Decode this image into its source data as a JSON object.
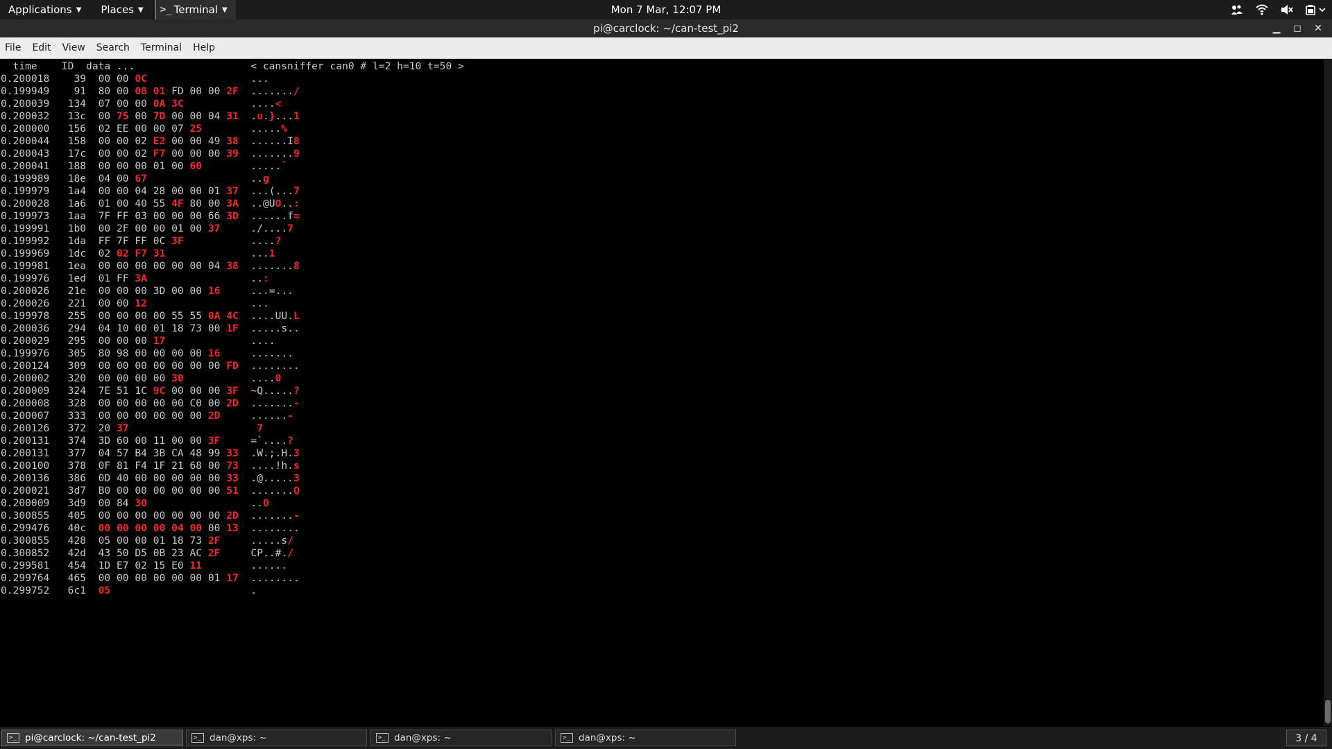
{
  "topbar": {
    "applications": "Applications",
    "places": "Places",
    "terminal_app": "Terminal",
    "clock": "Mon  7 Mar, 12:07 PM",
    "tray_icons": [
      "accessibility-icon",
      "wifi-icon",
      "volume-icon",
      "battery-icon"
    ]
  },
  "window": {
    "title": "pi@carclock: ~/can-test_pi2"
  },
  "menu": [
    "File",
    "Edit",
    "View",
    "Search",
    "Terminal",
    "Help"
  ],
  "terminal": {
    "header": {
      "time": "time",
      "id": "ID",
      "data": "data ...",
      "banner": "< cansniffer can0 # l=2 h=10 t=50 >"
    },
    "rows": [
      {
        "t": "0.200018",
        "id": "39",
        "b": [
          "00",
          "00",
          "0C"
        ],
        "hl": [
          2
        ],
        "a": "..."
      },
      {
        "t": "0.199949",
        "id": "91",
        "b": [
          "80",
          "00",
          "08",
          "01",
          "FD",
          "00",
          "00",
          "2F"
        ],
        "hl": [
          2,
          3,
          7
        ],
        "a": "......./",
        "ahl": [
          7
        ]
      },
      {
        "t": "0.200039",
        "id": "134",
        "b": [
          "07",
          "00",
          "00",
          "0A",
          "3C"
        ],
        "hl": [
          3,
          4
        ],
        "a": "....<",
        "ahl": [
          4
        ]
      },
      {
        "t": "0.200032",
        "id": "13c",
        "b": [
          "00",
          "75",
          "00",
          "7D",
          "00",
          "00",
          "04",
          "31"
        ],
        "hl": [
          1,
          3,
          7
        ],
        "a": ".u.}...1",
        "ahl": [
          1,
          3,
          7
        ]
      },
      {
        "t": "0.200000",
        "id": "156",
        "b": [
          "02",
          "EE",
          "00",
          "00",
          "07",
          "25"
        ],
        "hl": [
          5
        ],
        "a": ".....%",
        "ahl": [
          5
        ]
      },
      {
        "t": "0.200044",
        "id": "158",
        "b": [
          "00",
          "00",
          "02",
          "E2",
          "00",
          "00",
          "49",
          "38"
        ],
        "hl": [
          3,
          7
        ],
        "a": "......I8",
        "ahl": [
          7
        ]
      },
      {
        "t": "0.200043",
        "id": "17c",
        "b": [
          "00",
          "00",
          "02",
          "F7",
          "00",
          "00",
          "00",
          "39"
        ],
        "hl": [
          3,
          7
        ],
        "a": ".......9",
        "ahl": [
          7
        ]
      },
      {
        "t": "0.200041",
        "id": "188",
        "b": [
          "00",
          "00",
          "00",
          "01",
          "00",
          "60"
        ],
        "hl": [
          5
        ],
        "a": ".....`",
        "ahl": [
          5
        ]
      },
      {
        "t": "0.199989",
        "id": "18e",
        "b": [
          "04",
          "00",
          "67"
        ],
        "hl": [
          2
        ],
        "a": "..g",
        "ahl": [
          2
        ]
      },
      {
        "t": "0.199979",
        "id": "1a4",
        "b": [
          "00",
          "00",
          "04",
          "28",
          "00",
          "00",
          "01",
          "37"
        ],
        "hl": [
          7
        ],
        "a": "...(...7",
        "ahl": [
          7
        ]
      },
      {
        "t": "0.200028",
        "id": "1a6",
        "b": [
          "01",
          "00",
          "40",
          "55",
          "4F",
          "80",
          "00",
          "3A"
        ],
        "hl": [
          4,
          7
        ],
        "a": "..@UO..:",
        "ahl": [
          4,
          7
        ]
      },
      {
        "t": "0.199973",
        "id": "1aa",
        "b": [
          "7F",
          "FF",
          "03",
          "00",
          "00",
          "00",
          "66",
          "3D"
        ],
        "hl": [
          7
        ],
        "a": "......f=",
        "ahl": [
          7
        ]
      },
      {
        "t": "0.199991",
        "id": "1b0",
        "b": [
          "00",
          "2F",
          "00",
          "00",
          "01",
          "00",
          "37"
        ],
        "hl": [
          6
        ],
        "a": "./....7",
        "ahl": [
          6
        ]
      },
      {
        "t": "0.199992",
        "id": "1da",
        "b": [
          "FF",
          "7F",
          "FF",
          "0C",
          "3F"
        ],
        "hl": [
          4
        ],
        "a": "....?",
        "ahl": [
          4
        ]
      },
      {
        "t": "0.199969",
        "id": "1dc",
        "b": [
          "02",
          "02",
          "F7",
          "31"
        ],
        "hl": [
          1,
          2,
          3
        ],
        "a": "...1",
        "ahl": [
          3
        ]
      },
      {
        "t": "0.199981",
        "id": "1ea",
        "b": [
          "00",
          "00",
          "00",
          "00",
          "00",
          "00",
          "04",
          "38"
        ],
        "hl": [
          7
        ],
        "a": ".......8",
        "ahl": [
          7
        ]
      },
      {
        "t": "0.199976",
        "id": "1ed",
        "b": [
          "01",
          "FF",
          "3A"
        ],
        "hl": [
          2
        ],
        "a": "..:",
        "ahl": [
          2
        ]
      },
      {
        "t": "0.200026",
        "id": "21e",
        "b": [
          "00",
          "00",
          "00",
          "3D",
          "00",
          "00",
          "16"
        ],
        "hl": [
          6
        ],
        "a": "...=..."
      },
      {
        "t": "0.200026",
        "id": "221",
        "b": [
          "00",
          "00",
          "12"
        ],
        "hl": [
          2
        ],
        "a": "..."
      },
      {
        "t": "0.199978",
        "id": "255",
        "b": [
          "00",
          "00",
          "00",
          "00",
          "55",
          "55",
          "0A",
          "4C"
        ],
        "hl": [
          6,
          7
        ],
        "a": "....UU.L",
        "ahl": [
          7
        ]
      },
      {
        "t": "0.200036",
        "id": "294",
        "b": [
          "04",
          "10",
          "00",
          "01",
          "18",
          "73",
          "00",
          "1F"
        ],
        "hl": [
          7
        ],
        "a": ".....s.."
      },
      {
        "t": "0.200029",
        "id": "295",
        "b": [
          "00",
          "00",
          "00",
          "17"
        ],
        "hl": [
          3
        ],
        "a": "...."
      },
      {
        "t": "0.199976",
        "id": "305",
        "b": [
          "80",
          "98",
          "00",
          "00",
          "00",
          "00",
          "16"
        ],
        "hl": [
          6
        ],
        "a": "......."
      },
      {
        "t": "0.200124",
        "id": "309",
        "b": [
          "00",
          "00",
          "00",
          "00",
          "00",
          "00",
          "00",
          "FD"
        ],
        "hl": [
          7
        ],
        "a": "........"
      },
      {
        "t": "0.200002",
        "id": "320",
        "b": [
          "00",
          "00",
          "00",
          "00",
          "30"
        ],
        "hl": [
          4
        ],
        "a": "....0",
        "ahl": [
          4
        ]
      },
      {
        "t": "0.200009",
        "id": "324",
        "b": [
          "7E",
          "51",
          "1C",
          "9C",
          "00",
          "00",
          "00",
          "3F"
        ],
        "hl": [
          3,
          7
        ],
        "a": "~Q.....?",
        "ahl": [
          7
        ]
      },
      {
        "t": "0.200008",
        "id": "328",
        "b": [
          "00",
          "00",
          "00",
          "00",
          "00",
          "C0",
          "00",
          "2D"
        ],
        "hl": [
          7
        ],
        "a": ".......-",
        "ahl": [
          7
        ]
      },
      {
        "t": "0.200007",
        "id": "333",
        "b": [
          "00",
          "00",
          "00",
          "00",
          "00",
          "00",
          "2D"
        ],
        "hl": [
          6
        ],
        "a": "......-",
        "ahl": [
          6
        ]
      },
      {
        "t": "0.200126",
        "id": "372",
        "b": [
          "20",
          "37"
        ],
        "hl": [
          1
        ],
        "a": " 7",
        "ahl": [
          1
        ]
      },
      {
        "t": "0.200131",
        "id": "374",
        "b": [
          "3D",
          "60",
          "00",
          "11",
          "00",
          "00",
          "3F"
        ],
        "hl": [
          6
        ],
        "a": "=`....?",
        "ahl": [
          6
        ]
      },
      {
        "t": "0.200131",
        "id": "377",
        "b": [
          "04",
          "57",
          "B4",
          "3B",
          "CA",
          "48",
          "99",
          "33"
        ],
        "hl": [
          7
        ],
        "a": ".W.;.H.3",
        "ahl": [
          7
        ]
      },
      {
        "t": "0.200100",
        "id": "378",
        "b": [
          "0F",
          "81",
          "F4",
          "1F",
          "21",
          "68",
          "00",
          "73"
        ],
        "hl": [
          7
        ],
        "a": "....!h.s",
        "ahl": [
          7
        ]
      },
      {
        "t": "0.200136",
        "id": "386",
        "b": [
          "0D",
          "40",
          "00",
          "00",
          "00",
          "00",
          "00",
          "33"
        ],
        "hl": [
          7
        ],
        "a": ".@.....3",
        "ahl": [
          7
        ]
      },
      {
        "t": "0.200021",
        "id": "3d7",
        "b": [
          "B0",
          "00",
          "00",
          "00",
          "00",
          "00",
          "00",
          "51"
        ],
        "hl": [
          7
        ],
        "a": ".......Q",
        "ahl": [
          7
        ]
      },
      {
        "t": "0.200009",
        "id": "3d9",
        "b": [
          "00",
          "84",
          "30"
        ],
        "hl": [
          2
        ],
        "a": "..0",
        "ahl": [
          2
        ]
      },
      {
        "t": "0.300855",
        "id": "405",
        "b": [
          "00",
          "00",
          "00",
          "00",
          "00",
          "00",
          "00",
          "2D"
        ],
        "hl": [
          7
        ],
        "a": ".......-",
        "ahl": [
          7
        ]
      },
      {
        "t": "0.299476",
        "id": "40c",
        "b": [
          "00",
          "00",
          "00",
          "00",
          "04",
          "00",
          "00",
          "13"
        ],
        "hl": [
          0,
          1,
          2,
          3,
          4,
          5,
          7
        ],
        "a": "........"
      },
      {
        "t": "0.300855",
        "id": "428",
        "b": [
          "05",
          "00",
          "00",
          "01",
          "18",
          "73",
          "2F"
        ],
        "hl": [
          6
        ],
        "a": ".....s/",
        "ahl": [
          6
        ]
      },
      {
        "t": "0.300852",
        "id": "42d",
        "b": [
          "43",
          "50",
          "D5",
          "0B",
          "23",
          "AC",
          "2F"
        ],
        "hl": [
          6
        ],
        "a": "CP..#./",
        "ahl": [
          6
        ]
      },
      {
        "t": "0.299581",
        "id": "454",
        "b": [
          "1D",
          "E7",
          "02",
          "15",
          "E0",
          "11"
        ],
        "hl": [
          5
        ],
        "a": "......"
      },
      {
        "t": "0.299764",
        "id": "465",
        "b": [
          "00",
          "00",
          "00",
          "00",
          "00",
          "00",
          "01",
          "17"
        ],
        "hl": [
          7
        ],
        "a": "........"
      },
      {
        "t": "0.299752",
        "id": "6c1",
        "b": [
          "05"
        ],
        "hl": [
          0
        ],
        "a": "."
      }
    ]
  },
  "taskbar": {
    "tasks": [
      {
        "label": "pi@carclock: ~/can-test_pi2",
        "active": true
      },
      {
        "label": "dan@xps: ~",
        "active": false
      },
      {
        "label": "dan@xps: ~",
        "active": false
      },
      {
        "label": "dan@xps: ~",
        "active": false
      }
    ],
    "workspace": "3 / 4"
  }
}
